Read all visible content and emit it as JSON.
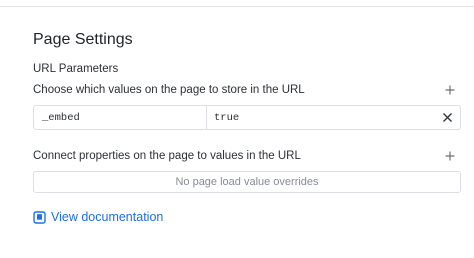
{
  "page": {
    "title": "Page Settings"
  },
  "url_parameters": {
    "section_label": "URL Parameters",
    "store_label": "Choose which values on the page to store in the URL",
    "add_icon": "plus-icon",
    "rows": [
      {
        "key": "_embed",
        "value": "true",
        "remove_icon": "close-icon"
      }
    ]
  },
  "overrides": {
    "label": "Connect properties on the page to values in the URL",
    "add_icon": "plus-icon",
    "empty_text": "No page load value overrides"
  },
  "documentation": {
    "link_text": "View documentation",
    "icon": "book-icon"
  },
  "colors": {
    "link": "#1e6fe6",
    "border": "#dcdfe4",
    "muted_text": "#868b94"
  }
}
